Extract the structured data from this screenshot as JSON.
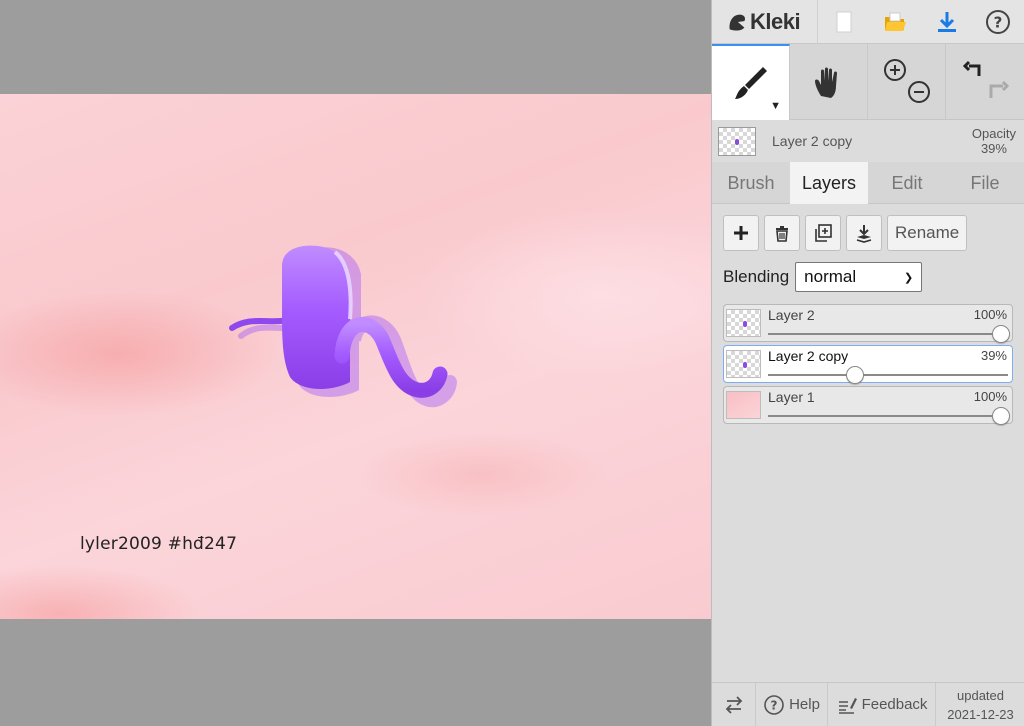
{
  "app": {
    "name": "Kleki"
  },
  "canvas": {
    "signature": "lyler2009   #hđ247"
  },
  "toolbar": {
    "top_icons": [
      "new-image-icon",
      "open-folder-icon",
      "download-icon",
      "help-icon"
    ],
    "tools": [
      "brush-tool",
      "hand-tool",
      "zoom-in-out",
      "undo-redo"
    ]
  },
  "current_layer": {
    "name": "Layer 2 copy",
    "opacity_label": "Opacity",
    "opacity_value": "39%"
  },
  "tabs": [
    "Brush",
    "Layers",
    "Edit",
    "File"
  ],
  "active_tab": "Layers",
  "layer_actions": {
    "rename": "Rename"
  },
  "blending": {
    "label": "Blending",
    "value": "normal"
  },
  "layers": [
    {
      "name": "Layer 2",
      "opacity": "100%",
      "level": 1.0,
      "active": false
    },
    {
      "name": "Layer 2 copy",
      "opacity": "39%",
      "level": 0.39,
      "active": true
    },
    {
      "name": "Layer 1",
      "opacity": "100%",
      "level": 1.0,
      "active": false
    }
  ],
  "footer": {
    "help": "Help",
    "feedback": "Feedback",
    "updated_label": "updated",
    "updated_date": "2021-12-23"
  },
  "colors": {
    "accent": "#3d8ff2",
    "stroke_purple": "#9b4dff",
    "canvas_pink": "#fbd2d7"
  }
}
